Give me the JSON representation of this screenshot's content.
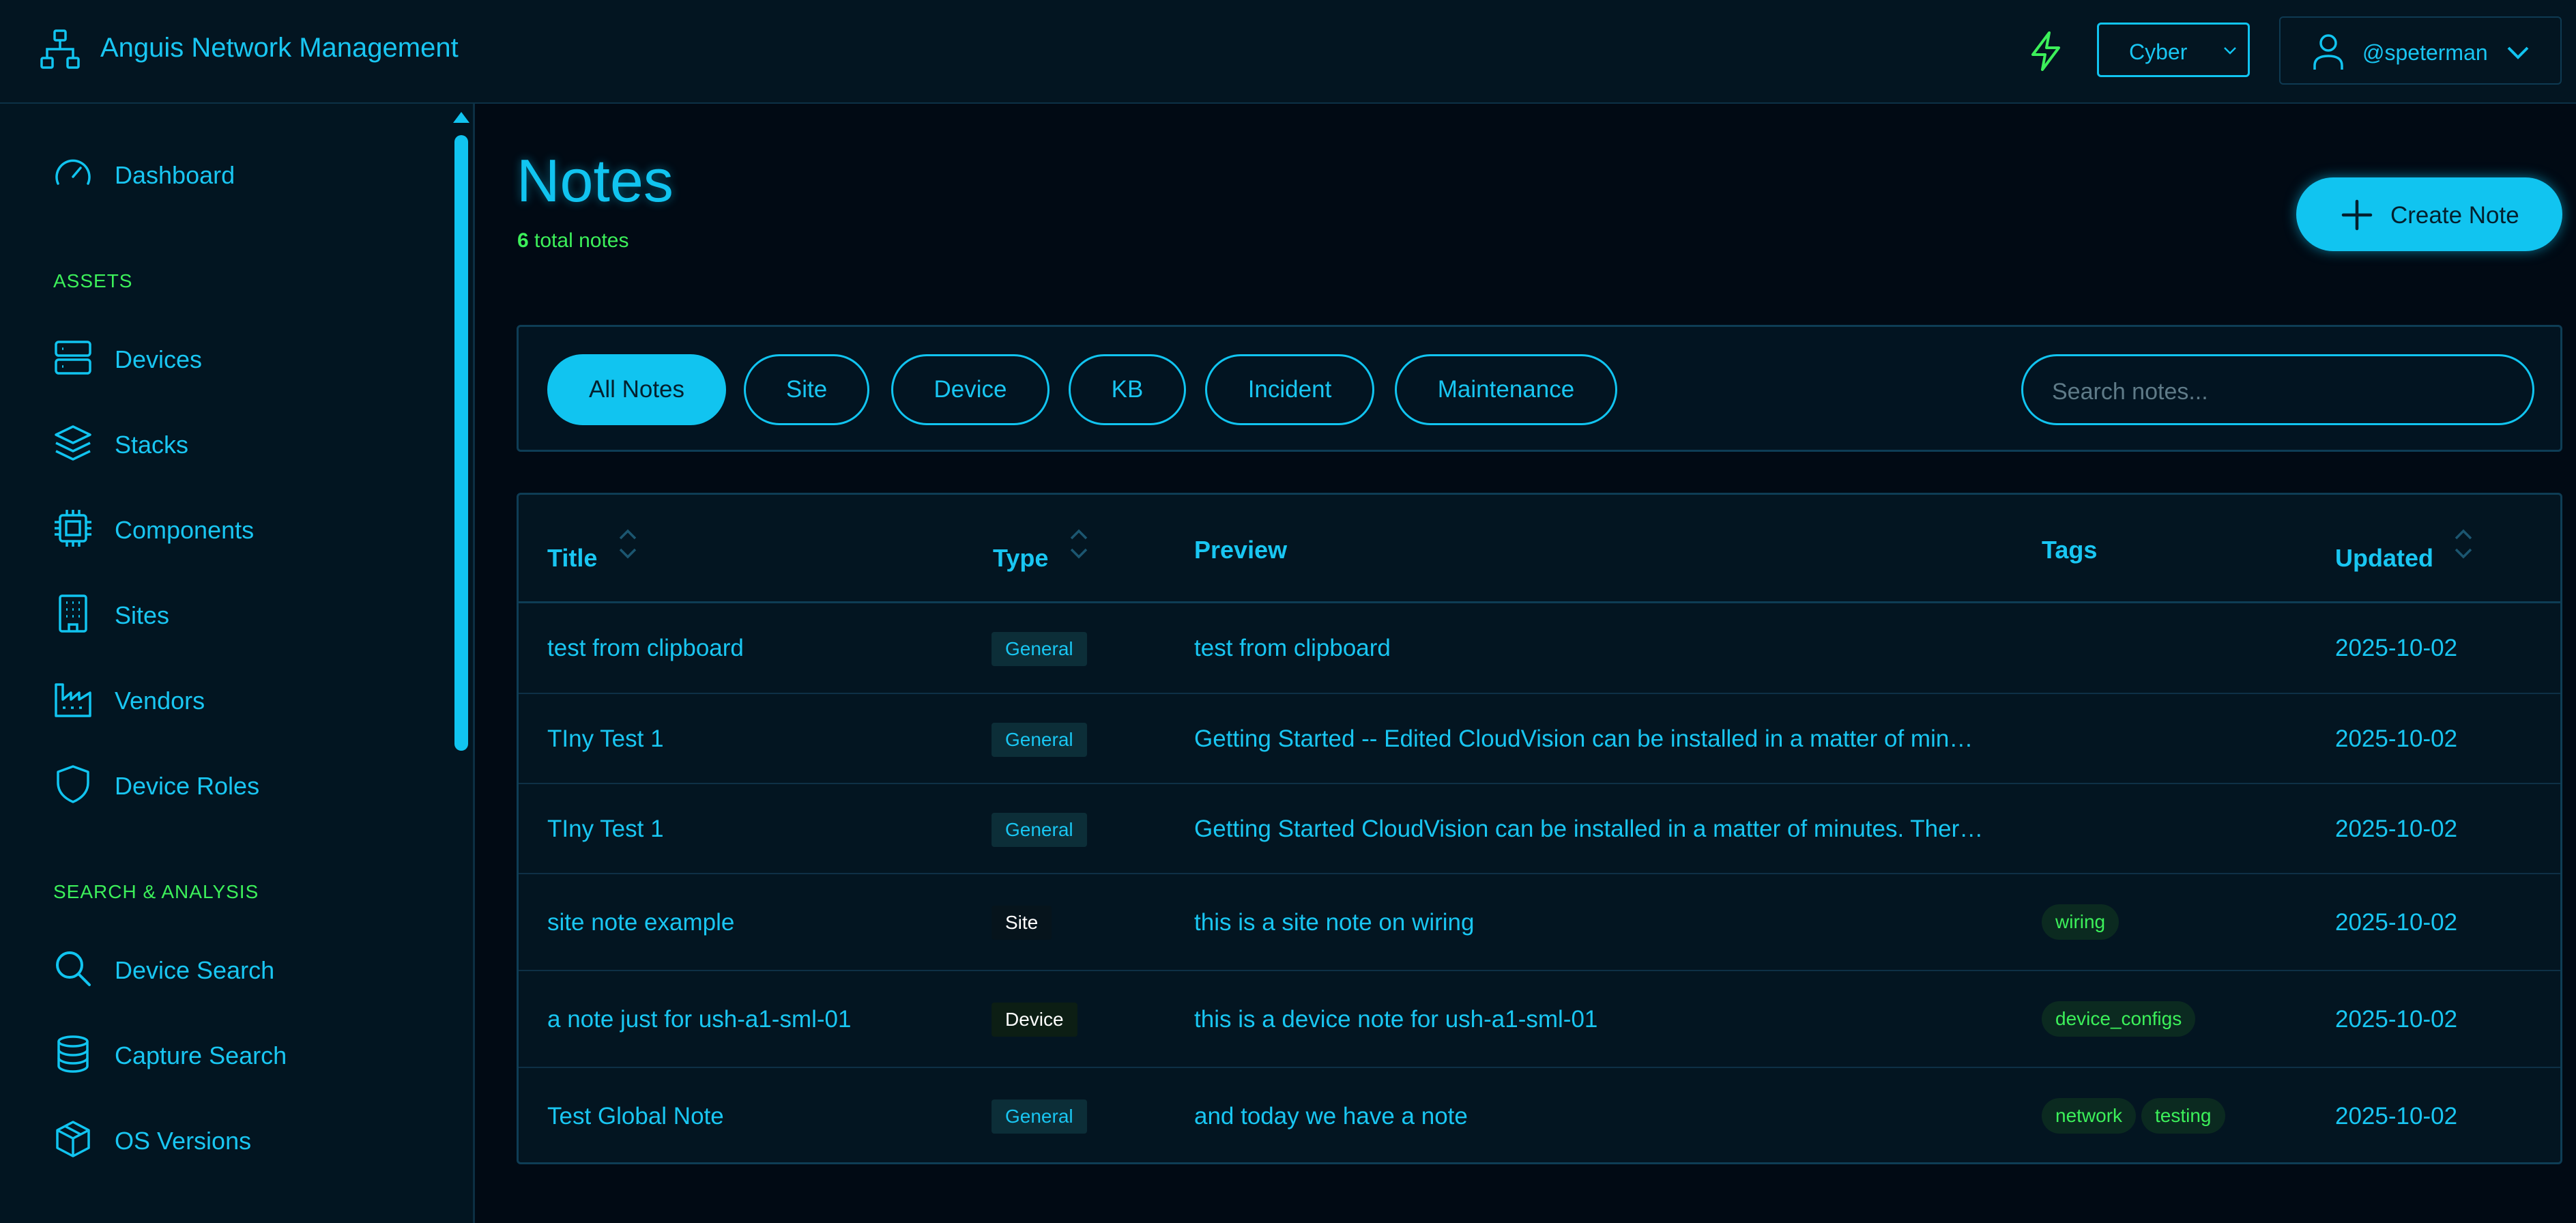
{
  "app": {
    "title": "Anguis Network Management",
    "theme_value": "Cyber",
    "username": "@speterman"
  },
  "colors": {
    "accent": "#11c4f0",
    "green": "#3cf05a",
    "background": "#010a14",
    "panel": "#031521"
  },
  "sidebar": {
    "items": [
      {
        "label": "Dashboard",
        "icon": "gauge-icon"
      }
    ],
    "sections": [
      {
        "title": "ASSETS",
        "items": [
          {
            "label": "Devices",
            "icon": "server-icon"
          },
          {
            "label": "Stacks",
            "icon": "layers-icon"
          },
          {
            "label": "Components",
            "icon": "chip-icon"
          },
          {
            "label": "Sites",
            "icon": "building-icon"
          },
          {
            "label": "Vendors",
            "icon": "factory-icon"
          },
          {
            "label": "Device Roles",
            "icon": "shield-icon"
          }
        ]
      },
      {
        "title": "SEARCH & ANALYSIS",
        "items": [
          {
            "label": "Device Search",
            "icon": "search-icon"
          },
          {
            "label": "Capture Search",
            "icon": "database-icon"
          },
          {
            "label": "OS Versions",
            "icon": "box-icon"
          }
        ]
      }
    ]
  },
  "main": {
    "title": "Notes",
    "count": "6",
    "count_suffix": "total notes",
    "create_label": "Create Note",
    "filters": [
      "All Notes",
      "Site",
      "Device",
      "KB",
      "Incident",
      "Maintenance"
    ],
    "active_filter": "All Notes",
    "search_placeholder": "Search notes...",
    "columns": [
      "Title",
      "Type",
      "Preview",
      "Tags",
      "Updated"
    ],
    "rows": [
      {
        "title": "test from clipboard",
        "type": "General",
        "preview": "test from clipboard",
        "tags": [],
        "updated": "2025-10-02"
      },
      {
        "title": "TIny Test 1",
        "type": "General",
        "preview": "Getting Started -- Edited CloudVision can be installed in a matter of min…",
        "tags": [],
        "updated": "2025-10-02"
      },
      {
        "title": "TIny Test 1",
        "type": "General",
        "preview": "Getting Started CloudVision can be installed in a matter of minutes. Ther…",
        "tags": [],
        "updated": "2025-10-02"
      },
      {
        "title": "site note example",
        "type": "Site",
        "preview": "this is a site note on wiring",
        "tags": [
          "wiring"
        ],
        "updated": "2025-10-02"
      },
      {
        "title": "a note just for ush-a1-sml-01",
        "type": "Device",
        "preview": "this is a device note for ush-a1-sml-01",
        "tags": [
          "device_configs"
        ],
        "updated": "2025-10-02"
      },
      {
        "title": "Test Global Note",
        "type": "General",
        "preview": "and today we have a note",
        "tags": [
          "network",
          "testing"
        ],
        "updated": "2025-10-02"
      }
    ]
  }
}
